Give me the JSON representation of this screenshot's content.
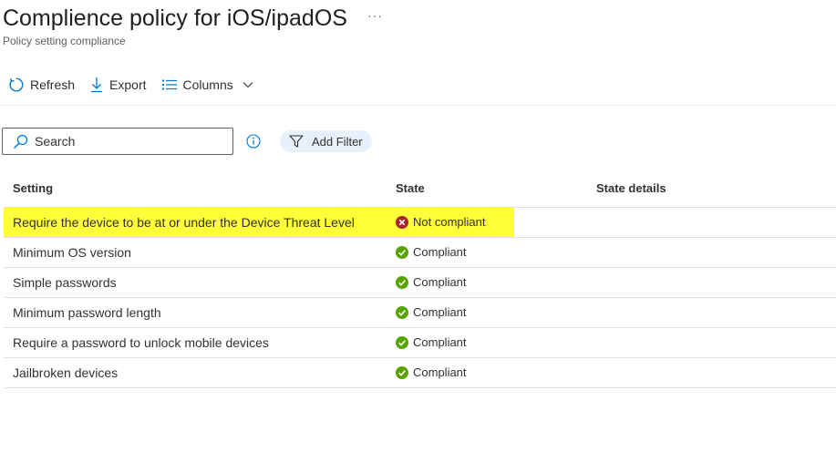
{
  "header": {
    "title": "Complience policy for iOS/ipadOS",
    "subtitle": "Policy setting compliance",
    "more_label": "···"
  },
  "toolbar": {
    "refresh_label": "Refresh",
    "export_label": "Export",
    "columns_label": "Columns"
  },
  "filters": {
    "search_placeholder": "Search",
    "add_filter_label": "Add Filter"
  },
  "table": {
    "columns": [
      "Setting",
      "State",
      "State details"
    ],
    "rows": [
      {
        "setting": "Require the device to be at or under the Device Threat Level",
        "state": "Not compliant",
        "status": "error",
        "highlighted": true
      },
      {
        "setting": "Minimum OS version",
        "state": "Compliant",
        "status": "success"
      },
      {
        "setting": "Simple passwords",
        "state": "Compliant",
        "status": "success"
      },
      {
        "setting": "Minimum password length",
        "state": "Compliant",
        "status": "success"
      },
      {
        "setting": "Require a password to unlock mobile devices",
        "state": "Compliant",
        "status": "success"
      },
      {
        "setting": "Jailbroken devices",
        "state": "Compliant",
        "status": "success"
      }
    ]
  },
  "colors": {
    "accent": "#0078d4",
    "success": "#57a300",
    "error": "#a4262c",
    "highlight": "#ffff3a",
    "filter_pill": "#e8f1fb"
  },
  "icons": {
    "refresh": "refresh-icon",
    "export": "download-icon",
    "columns": "list-icon",
    "search": "search-icon",
    "info": "info-icon",
    "filter": "funnel-icon",
    "success": "checkmark-circle-icon",
    "error": "error-circle-icon"
  }
}
